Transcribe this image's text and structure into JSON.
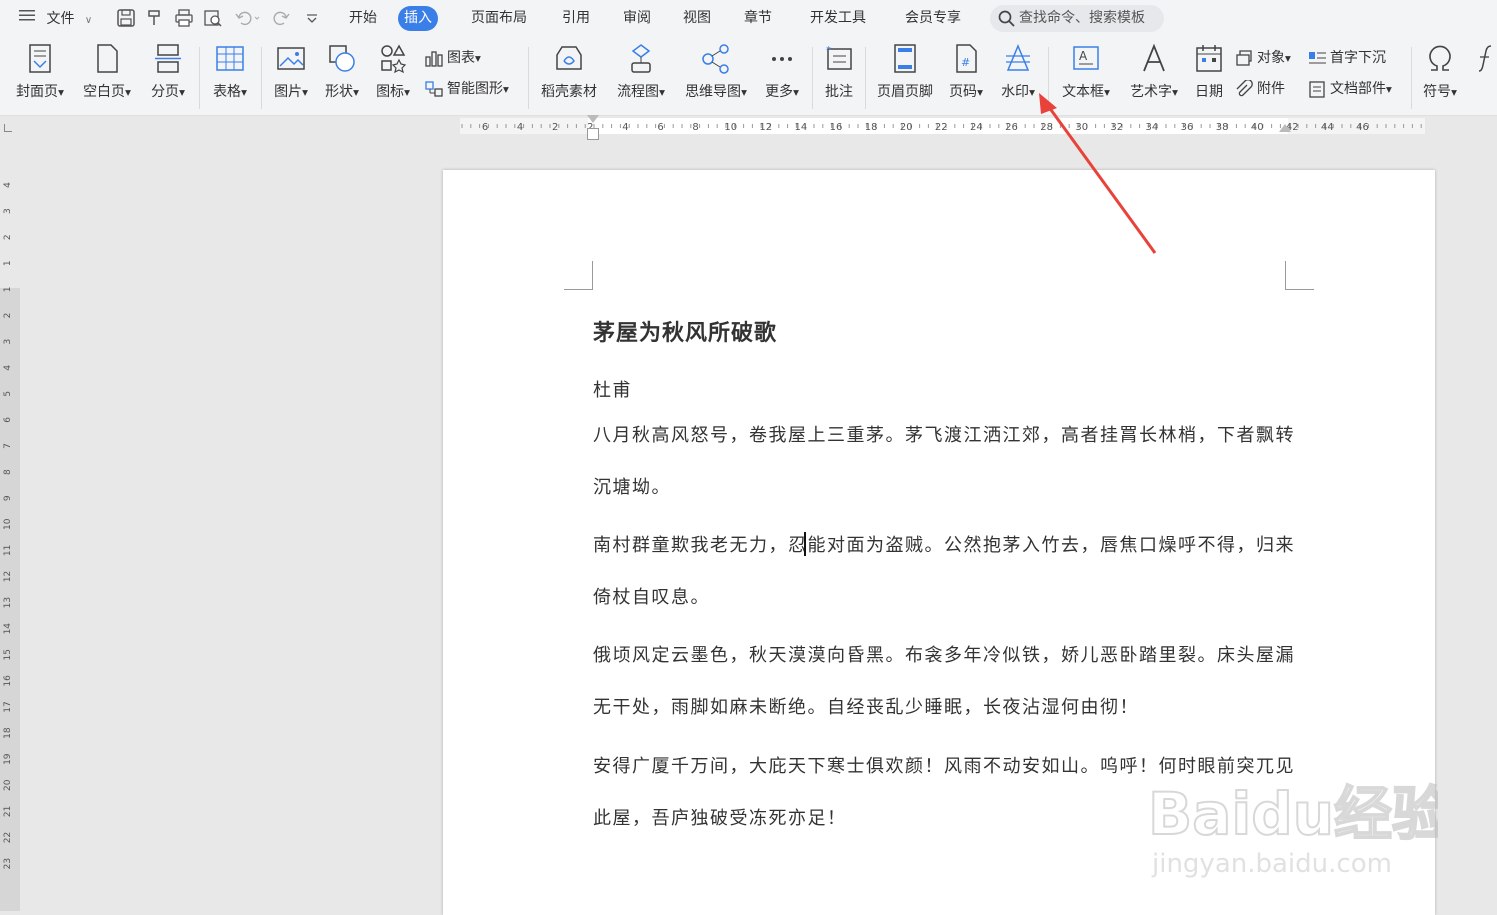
{
  "menubar": {
    "file_label": "文件",
    "tabs": [
      "开始",
      "插入",
      "页面布局",
      "引用",
      "审阅",
      "视图",
      "章节",
      "开发工具",
      "会员专享"
    ],
    "active_tab": "插入",
    "search_placeholder": "查找命令、搜索模板"
  },
  "ribbon": {
    "cover_page": "封面页",
    "blank_page": "空白页",
    "page_break": "分页",
    "table": "表格",
    "picture": "图片",
    "shape": "形状",
    "icon": "图标",
    "chart": "图表",
    "smart_art": "智能图形",
    "docer_assets": "稻壳素材",
    "flowchart": "流程图",
    "mind_map": "思维导图",
    "more": "更多",
    "comment": "批注",
    "header_footer": "页眉页脚",
    "page_number": "页码",
    "watermark": "水印",
    "text_box": "文本框",
    "word_art": "艺术字",
    "date": "日期",
    "object": "对象",
    "attachment": "附件",
    "drop_cap": "首字下沉",
    "doc_parts": "文档部件",
    "symbol": "符号",
    "formula": "公式"
  },
  "hruler_labels": [
    "6",
    "4",
    "2",
    "2",
    "4",
    "6",
    "8",
    "10",
    "12",
    "14",
    "16",
    "18",
    "20",
    "22",
    "24",
    "26",
    "28",
    "30",
    "32",
    "34",
    "36",
    "38",
    "40",
    "42",
    "44",
    "46"
  ],
  "vruler_labels": [
    "4",
    "3",
    "2",
    "1",
    "1",
    "2",
    "3",
    "4",
    "5",
    "6",
    "7",
    "8",
    "9",
    "10",
    "11",
    "12",
    "13",
    "14",
    "15",
    "16",
    "17",
    "18",
    "19",
    "20",
    "21",
    "22",
    "23"
  ],
  "document": {
    "title": "茅屋为秋风所破歌",
    "author": "杜甫",
    "lines": [
      "八月秋高风怒号，卷我屋上三重茅。茅飞渡江洒江郊，高者挂罥长林梢，下者飘转",
      "沉塘坳。",
      "南村群童欺我老无力，忍能对面为盗贼。公然抱茅入竹去，唇焦口燥呼不得，归来",
      "倚杖自叹息。",
      "俄顷风定云墨色，秋天漠漠向昏黑。布衾多年冷似铁，娇儿恶卧踏里裂。床头屋漏",
      "无干处，雨脚如麻未断绝。自经丧乱少睡眠，长夜沾湿何由彻！",
      "安得广厦千万间，大庇天下寒士俱欢颜！风雨不动安如山。呜呼！何时眼前突兀见",
      "此屋，吾庐独破受冻死亦足！"
    ]
  },
  "watermark_overlay": {
    "brand": "Baidu经验",
    "url": "jingyan.baidu.com"
  },
  "colors": {
    "accent": "#3a7ee8",
    "arrow": "#e8423a"
  }
}
